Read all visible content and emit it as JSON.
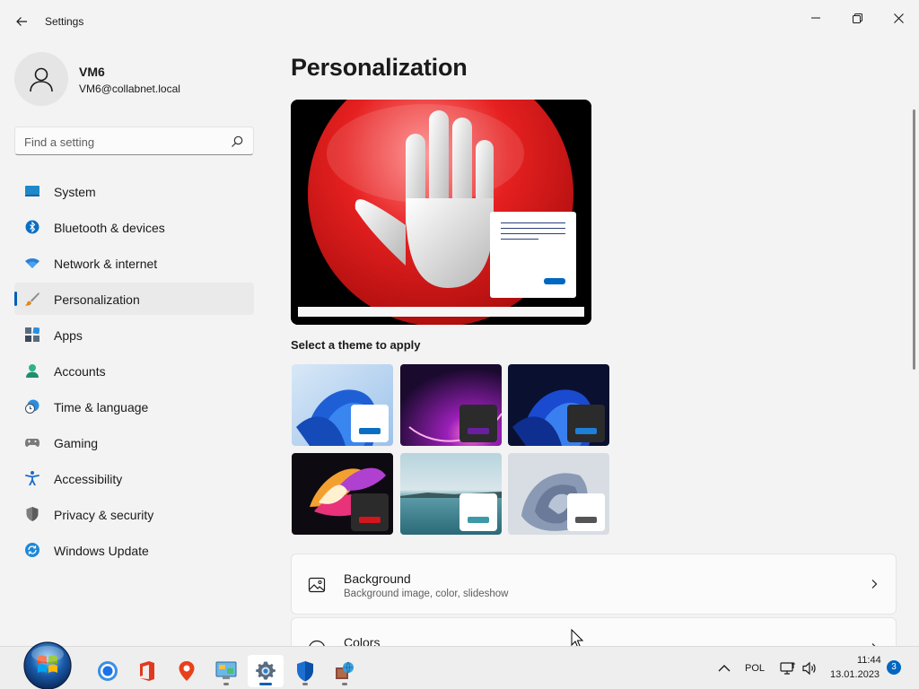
{
  "window": {
    "title": "Settings"
  },
  "user": {
    "name": "VM6",
    "email": "VM6@collabnet.local"
  },
  "search": {
    "placeholder": "Find a setting",
    "value": ""
  },
  "sidebar": {
    "items": [
      {
        "label": "System",
        "icon": "system-icon",
        "active": false
      },
      {
        "label": "Bluetooth & devices",
        "icon": "bluetooth-icon",
        "active": false
      },
      {
        "label": "Network & internet",
        "icon": "wifi-icon",
        "active": false
      },
      {
        "label": "Personalization",
        "icon": "brush-icon",
        "active": true
      },
      {
        "label": "Apps",
        "icon": "apps-icon",
        "active": false
      },
      {
        "label": "Accounts",
        "icon": "accounts-icon",
        "active": false
      },
      {
        "label": "Time & language",
        "icon": "clock-globe-icon",
        "active": false
      },
      {
        "label": "Gaming",
        "icon": "gamepad-icon",
        "active": false
      },
      {
        "label": "Accessibility",
        "icon": "accessibility-icon",
        "active": false
      },
      {
        "label": "Privacy & security",
        "icon": "shield-icon",
        "active": false
      },
      {
        "label": "Windows Update",
        "icon": "update-icon",
        "active": false
      }
    ]
  },
  "main": {
    "title": "Personalization",
    "themes_label": "Select a theme to apply",
    "themes": [
      {
        "name": "windows-light",
        "accent": "#0a6fc2"
      },
      {
        "name": "glow",
        "accent": "#6a1fa0"
      },
      {
        "name": "windows-dark",
        "accent": "#1e7fd8"
      },
      {
        "name": "captured-motion",
        "accent": "#d2161e"
      },
      {
        "name": "sunrise",
        "accent": "#3a9aa8"
      },
      {
        "name": "flow",
        "accent": "#555555"
      }
    ],
    "cards": [
      {
        "title": "Background",
        "subtitle": "Background image, color, slideshow",
        "icon": "picture-icon"
      },
      {
        "title": "Colors",
        "subtitle": "",
        "icon": "palette-icon"
      }
    ]
  },
  "taskbar": {
    "apps": [
      {
        "name": "chrome",
        "icon": "chrome-icon",
        "active": false,
        "running": false
      },
      {
        "name": "office",
        "icon": "office-icon",
        "active": false,
        "running": false
      },
      {
        "name": "maps",
        "icon": "map-pin-icon",
        "active": false,
        "running": false
      },
      {
        "name": "control-panel",
        "icon": "control-panel-icon",
        "active": false,
        "running": true
      },
      {
        "name": "settings",
        "icon": "gear-icon",
        "active": true,
        "running": true
      },
      {
        "name": "defender",
        "icon": "defender-shield-icon",
        "active": false,
        "running": true
      },
      {
        "name": "network-tool",
        "icon": "network-globe-icon",
        "active": false,
        "running": true
      }
    ],
    "language": "POL",
    "time": "11:44",
    "date": "13.01.2023",
    "notifications": "3"
  },
  "colors": {
    "accent": "#005fb8",
    "preview_red": "#d2161e"
  }
}
